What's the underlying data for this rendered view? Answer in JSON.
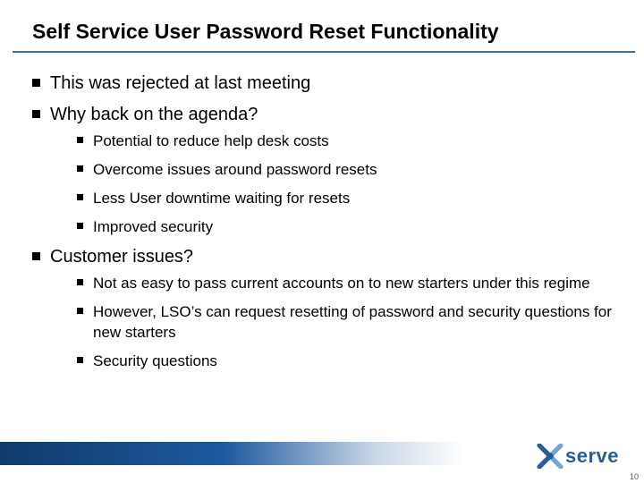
{
  "title": "Self Service User Password Reset Functionality",
  "bullets": {
    "l1_0": "This was rejected at last meeting",
    "l1_1": "Why back on the agenda?",
    "l1_1_sub": {
      "s0": "Potential to reduce help desk costs",
      "s1": "Overcome issues around password resets",
      "s2": "Less User downtime waiting for resets",
      "s3": "Improved security"
    },
    "l1_2": "Customer issues?",
    "l1_2_sub": {
      "s0": "Not as easy to pass current accounts on to new starters under this regime",
      "s1": "However, LSO’s can request resetting of password and security questions for new starters",
      "s2": "Security questions"
    }
  },
  "footer": {
    "brand_word": "serve",
    "page_number": "10"
  },
  "colors": {
    "rule": "#3f6fa3",
    "brand": "#2a5d93",
    "band_dark": "#103a6b"
  }
}
